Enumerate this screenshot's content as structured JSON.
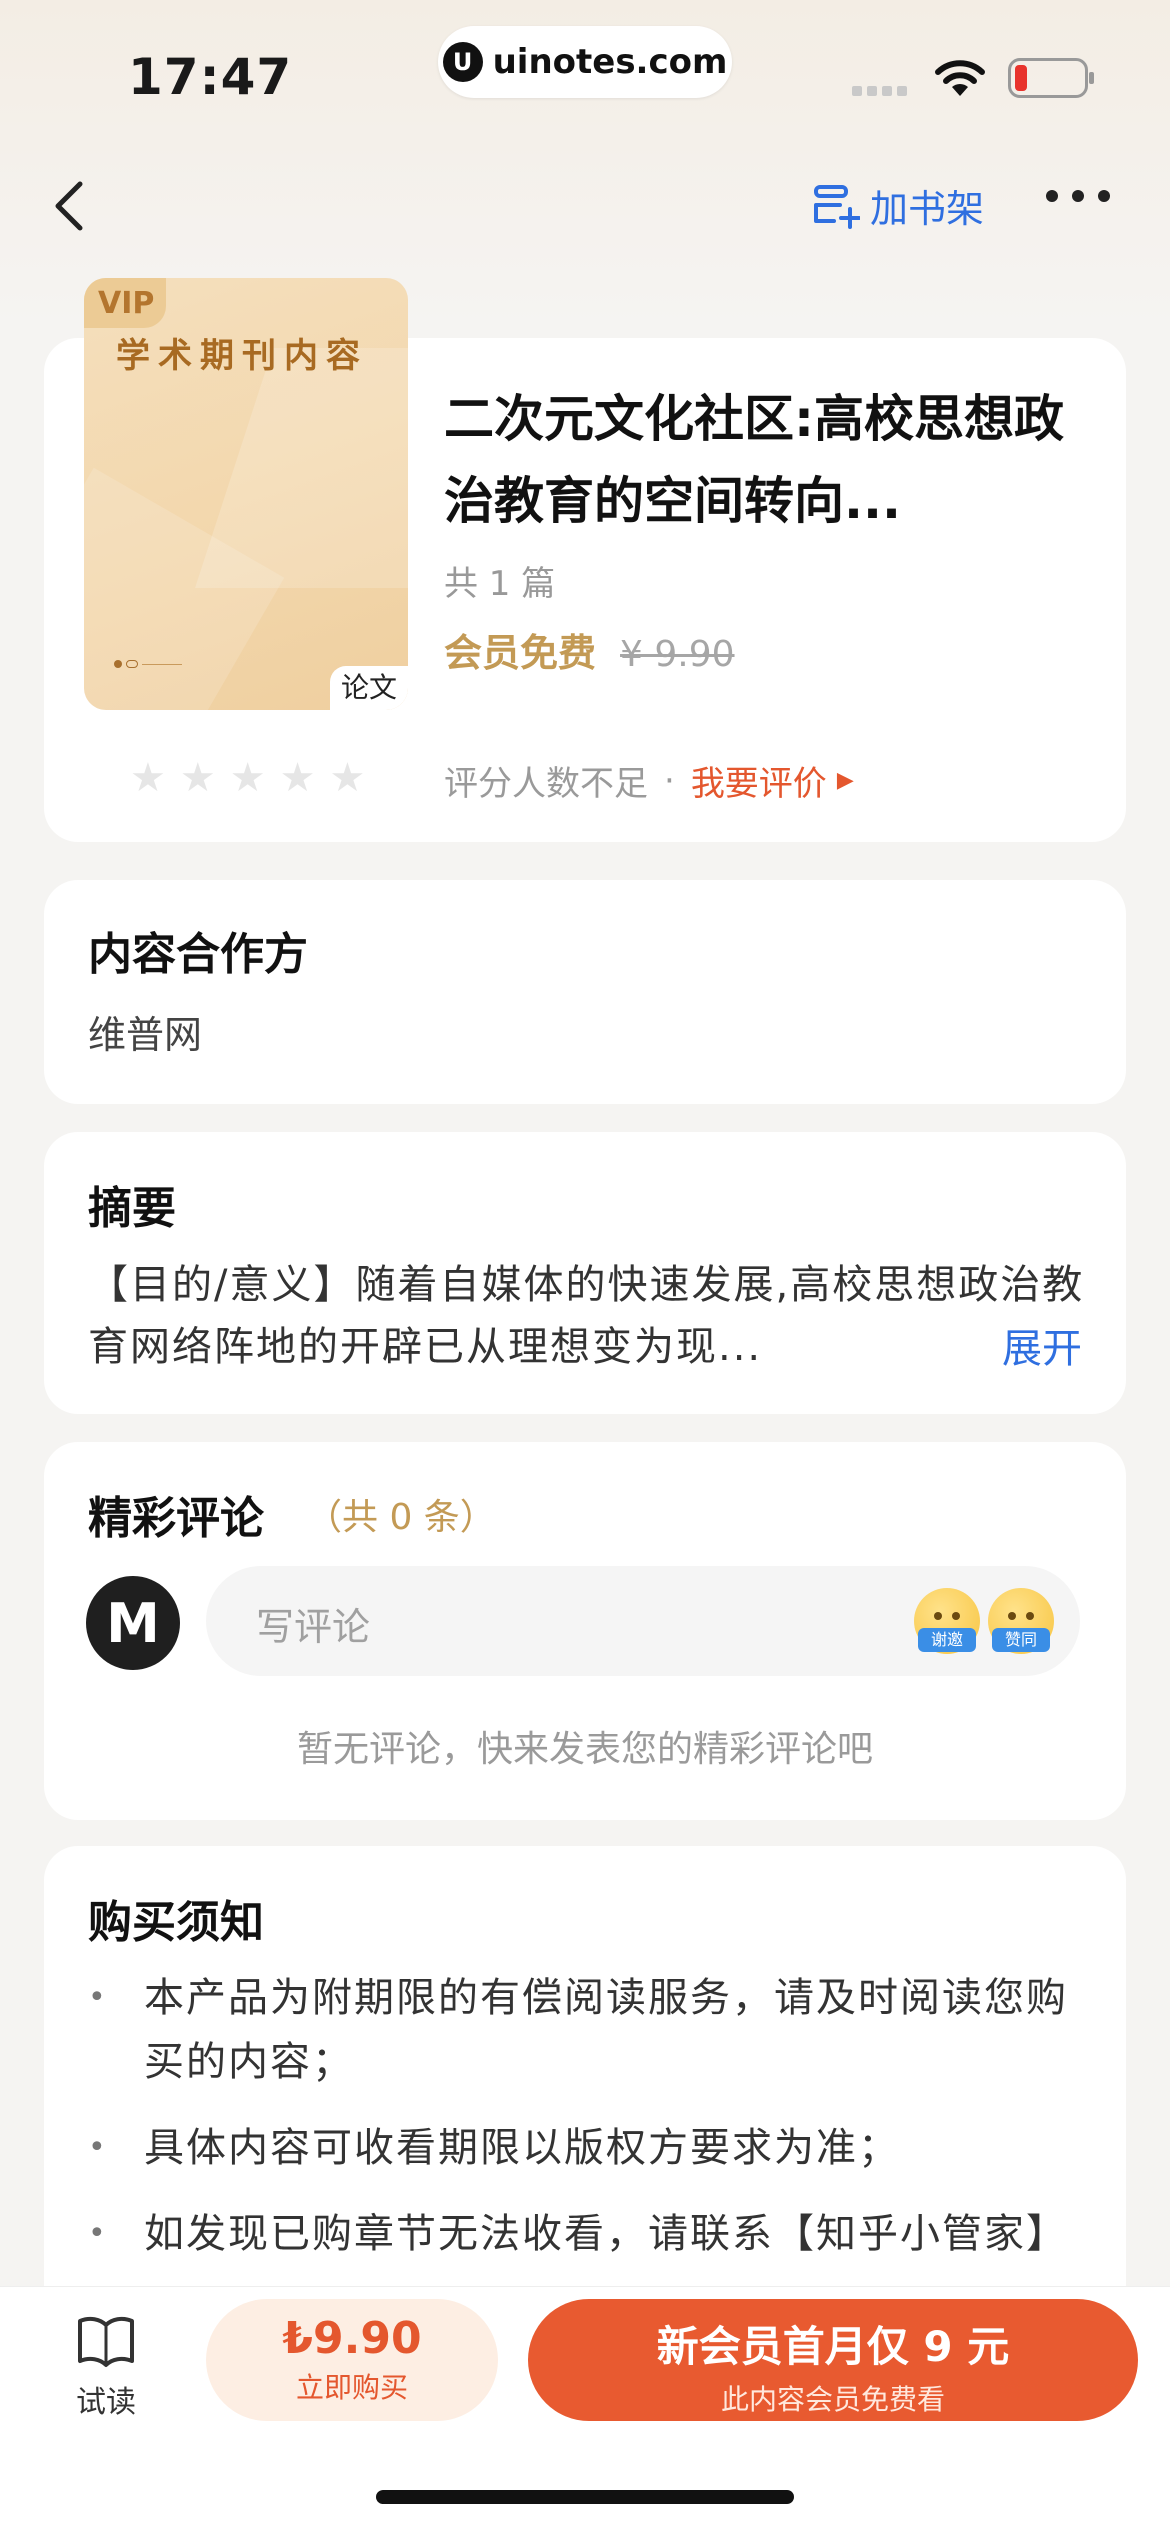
{
  "status_bar": {
    "time": "17:47",
    "url": "uinotes.com",
    "url_logo": "U"
  },
  "nav": {
    "shelf_label": "加书架"
  },
  "book": {
    "cover_vip": "VIP",
    "cover_title": "学术期刊内容",
    "type_tag": "论文",
    "title": "二次元文化社区:高校思想政治教育的空间转向...",
    "count": "共 1 篇",
    "member_price": "会员免费",
    "original_price": "¥ 9.90",
    "rating_stars": 0,
    "rating_none": "评分人数不足",
    "rating_sep": "·",
    "rate_link": "我要评价"
  },
  "partner": {
    "heading": "内容合作方",
    "name": "维普网"
  },
  "abstract": {
    "heading": "摘要",
    "text": "【目的/意义】随着自媒体的快速发展,高校思想政治教育网络阵地的开辟已从理想变为现...",
    "expand": "展开"
  },
  "comments": {
    "heading": "精彩评论",
    "count": "（共 0 条）",
    "avatar": "M",
    "placeholder": "写评论",
    "emoji_1": "谢邀",
    "emoji_2": "赞同",
    "empty": "暂无评论，快来发表您的精彩评论吧"
  },
  "notice": {
    "heading": "购买须知",
    "items": [
      "本产品为附期限的有偿阅读服务，请及时阅读您购买的内容；",
      "具体内容可收看期限以版权方要求为准；",
      "如发现已购章节无法收看，请联系【知乎小管家】"
    ]
  },
  "bottom": {
    "trial_label": "试读",
    "buy_price": "₺9.90",
    "buy_label": "立即购买",
    "member_title": "新会员首月仅 9 元",
    "member_sub": "此内容会员免费看"
  },
  "colors": {
    "accent": "#e85a30",
    "gold": "#c39a55",
    "link": "#2f6fe0"
  }
}
